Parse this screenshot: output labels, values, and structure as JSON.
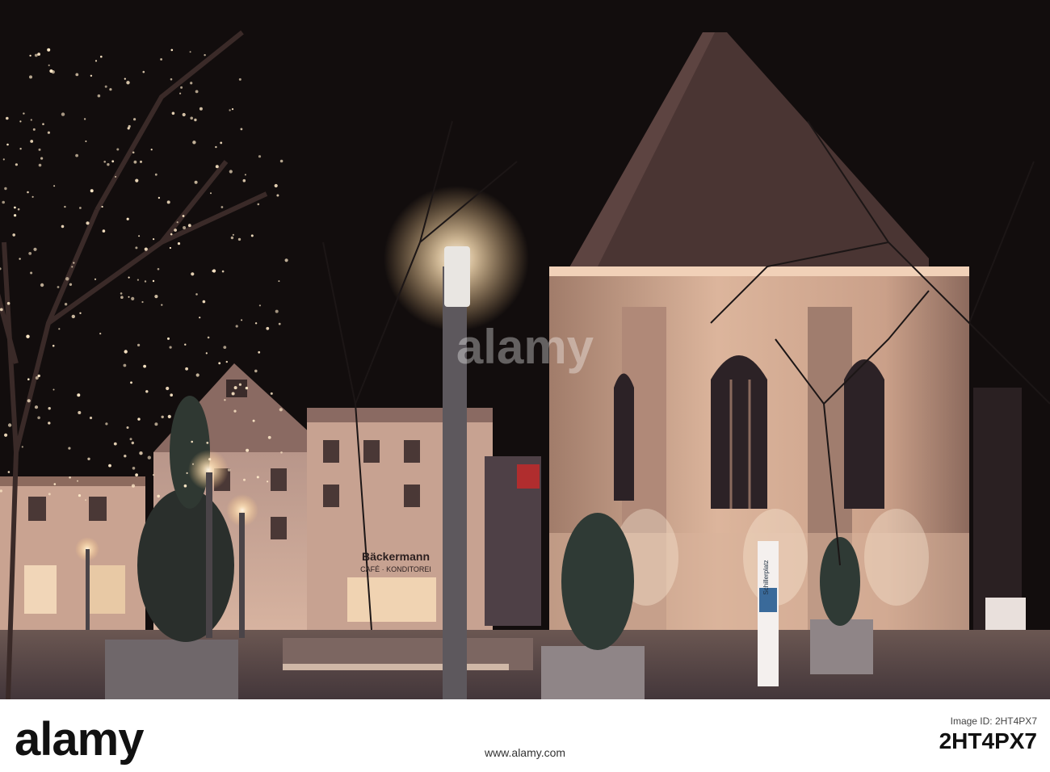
{
  "photo": {
    "shop_sign": "Bäckermann",
    "shop_sign_sub": "CAFÉ · KONDITOREI",
    "street_sign": "Schillerplatz"
  },
  "watermark": "alamy",
  "banner": {
    "logo": "alamy",
    "image_id_label": "Image ID: 2HT4PX7",
    "image_id": "2HT4PX7",
    "url": "www.alamy.com"
  },
  "colors": {
    "sky": "#120d0d",
    "church_light": "#d4a98a",
    "ground": "#5c4a45"
  }
}
